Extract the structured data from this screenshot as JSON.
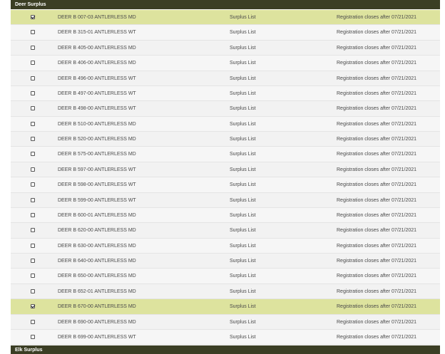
{
  "deer_section": {
    "title": "Deer Surplus"
  },
  "elk_section": {
    "title": "Elk Surplus"
  },
  "rows": [
    {
      "checked": true,
      "name": "DEER B 007-03 ANTLERLESS MD",
      "list": "Surplus List",
      "registration": "Registration closes after 07/21/2021"
    },
    {
      "checked": false,
      "name": "DEER B 315-01 ANTLERLESS WT",
      "list": "Surplus List",
      "registration": "Registration closes after 07/21/2021"
    },
    {
      "checked": false,
      "name": "DEER B 405-00 ANTLERLESS MD",
      "list": "Surplus List",
      "registration": "Registration closes after 07/21/2021"
    },
    {
      "checked": false,
      "name": "DEER B 406-00 ANTLERLESS MD",
      "list": "Surplus List",
      "registration": "Registration closes after 07/21/2021"
    },
    {
      "checked": false,
      "name": "DEER B 496-00 ANTLERLESS WT",
      "list": "Surplus List",
      "registration": "Registration closes after 07/21/2021"
    },
    {
      "checked": false,
      "name": "DEER B 497-00 ANTLERLESS WT",
      "list": "Surplus List",
      "registration": "Registration closes after 07/21/2021"
    },
    {
      "checked": false,
      "name": "DEER B 498-00 ANTLERLESS WT",
      "list": "Surplus List",
      "registration": "Registration closes after 07/21/2021"
    },
    {
      "checked": false,
      "name": "DEER B 510-00 ANTLERLESS MD",
      "list": "Surplus List",
      "registration": "Registration closes after 07/21/2021"
    },
    {
      "checked": false,
      "name": "DEER B 520-00 ANTLERLESS MD",
      "list": "Surplus List",
      "registration": "Registration closes after 07/21/2021"
    },
    {
      "checked": false,
      "name": "DEER B 575-00 ANTLERLESS MD",
      "list": "Surplus List",
      "registration": "Registration closes after 07/21/2021"
    },
    {
      "checked": false,
      "name": "DEER B 597-00 ANTLERLESS WT",
      "list": "Surplus List",
      "registration": "Registration closes after 07/21/2021"
    },
    {
      "checked": false,
      "name": "DEER B 598-00 ANTLERLESS WT",
      "list": "Surplus List",
      "registration": "Registration closes after 07/21/2021"
    },
    {
      "checked": false,
      "name": "DEER B 599-00 ANTLERLESS WT",
      "list": "Surplus List",
      "registration": "Registration closes after 07/21/2021"
    },
    {
      "checked": false,
      "name": "DEER B 600-01 ANTLERLESS MD",
      "list": "Surplus List",
      "registration": "Registration closes after 07/21/2021"
    },
    {
      "checked": false,
      "name": "DEER B 620-00 ANTLERLESS MD",
      "list": "Surplus List",
      "registration": "Registration closes after 07/21/2021"
    },
    {
      "checked": false,
      "name": "DEER B 630-00 ANTLERLESS MD",
      "list": "Surplus List",
      "registration": "Registration closes after 07/21/2021"
    },
    {
      "checked": false,
      "name": "DEER B 640-00 ANTLERLESS MD",
      "list": "Surplus List",
      "registration": "Registration closes after 07/21/2021"
    },
    {
      "checked": false,
      "name": "DEER B 650-00 ANTLERLESS MD",
      "list": "Surplus List",
      "registration": "Registration closes after 07/21/2021"
    },
    {
      "checked": false,
      "name": "DEER B 652-01 ANTLERLESS MD",
      "list": "Surplus List",
      "registration": "Registration closes after 07/21/2021"
    },
    {
      "checked": true,
      "name": "DEER B 670-00 ANTLERLESS MD",
      "list": "Surplus List",
      "registration": "Registration closes after 07/21/2021"
    },
    {
      "checked": false,
      "name": "DEER B 690-00 ANTLERLESS MD",
      "list": "Surplus List",
      "registration": "Registration closes after 07/21/2021"
    },
    {
      "checked": false,
      "name": "DEER B 699-00 ANTLERLESS WT",
      "list": "Surplus List",
      "registration": "Registration closes after 07/21/2021"
    }
  ]
}
